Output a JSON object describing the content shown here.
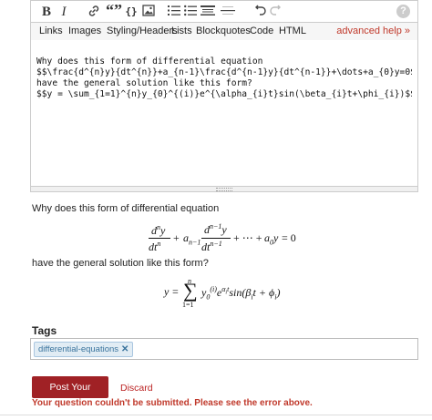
{
  "toolbar": {
    "bold": "B",
    "italic": "I",
    "quote": "“”",
    "code": "{}",
    "help": "?"
  },
  "tabs": [
    "Links",
    "Images",
    "Styling/Headers",
    "Lists",
    "Blockquotes",
    "Code",
    "HTML"
  ],
  "advanced_help": "advanced help »",
  "editor": {
    "content": "Why does this form of differential equation\n$$\\frac{d^{n}y}{dt^{n}}+a_{n-1}\\frac{d^{n-1}y}{dt^{n-1}}+\\dots+a_{0}y=0$$\nhave the general solution like this form?\n$$y = \\sum_{1=1}^{n}y_{0}^{(i)}e^{\\alpha_{i}t}sin(\\beta_{i}t+\\phi_{i})$$"
  },
  "preview": {
    "line1": "Why does this form of differential equation",
    "line2": "have the general solution like this form?"
  },
  "tags": {
    "label": "Tags",
    "items": [
      "differential-equations"
    ],
    "remove_glyph": "✕"
  },
  "actions": {
    "post": "Post Your Question",
    "discard": "Discard",
    "error": "Your question couldn't be submitted. Please see the error above."
  },
  "colors": {
    "accent": "#a02125",
    "link": "#c0392b",
    "tag_bg": "#e1ecf4",
    "tag_text": "#39739d"
  }
}
